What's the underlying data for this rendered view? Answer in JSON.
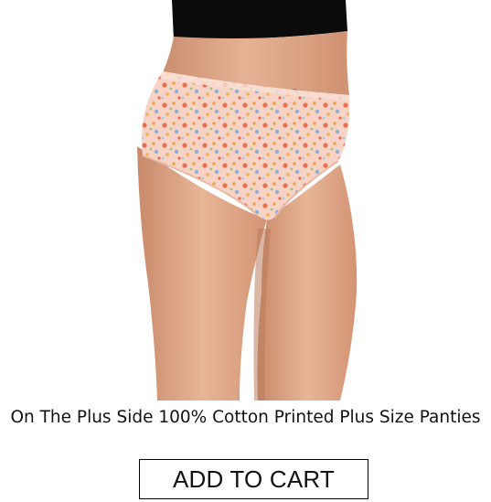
{
  "product": {
    "image_alt": "floral print high-waist cotton panties",
    "title": "On The Plus Side 100% Cotton Printed Plus Size Panties",
    "add_to_cart_label": "ADD TO CART"
  },
  "colors": {
    "background": "#ffffff",
    "text": "#111111",
    "button_border": "#000000",
    "skin": "#e0a887",
    "top": "#0a0a0a",
    "print_base": "#f6d3c4"
  }
}
